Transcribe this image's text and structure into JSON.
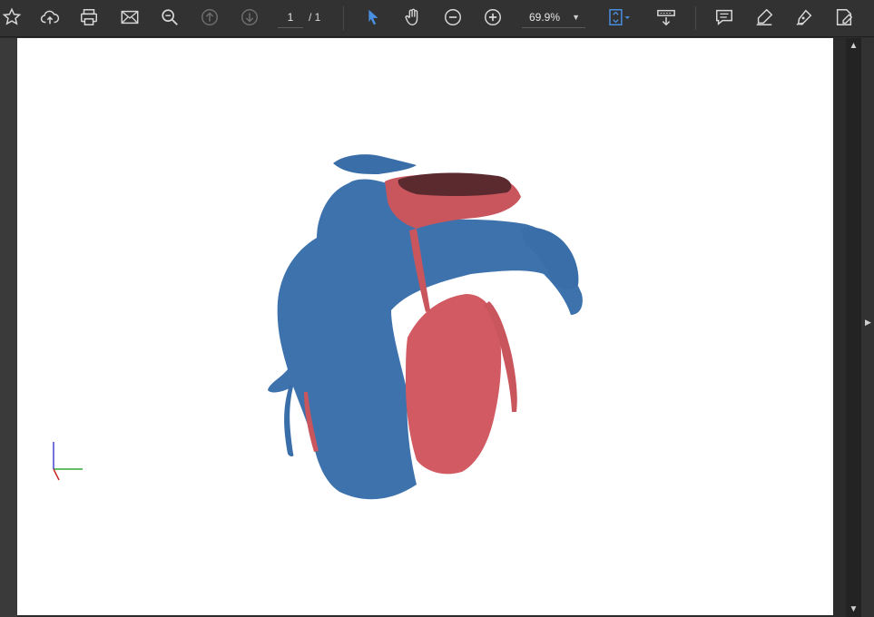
{
  "toolbar": {
    "page_current": "1",
    "page_total": "/ 1",
    "zoom_value": "69.9%",
    "icons": [
      "star-icon",
      "cloud-upload-icon",
      "print-icon",
      "mail-icon",
      "zoom-search-icon",
      "page-up-icon",
      "page-down-icon",
      "select-cursor-icon",
      "hand-tool-icon",
      "zoom-out-icon",
      "zoom-in-icon",
      "fit-page-icon",
      "read-mode-icon",
      "comment-icon",
      "highlight-icon",
      "sign-icon",
      "fill-sign-icon"
    ],
    "accent": "#4a90e2"
  },
  "document": {
    "content": "3D render of a heart with blue and red surfaces and coronary vessels",
    "colors": {
      "blue_region": "#3d72ad",
      "red_region": "#d25a62",
      "dark_red": "#5a2a2e"
    },
    "axis_triad_colors": {
      "x": "#33aa33",
      "y": "#4444cc",
      "z": "#cc2222"
    }
  }
}
